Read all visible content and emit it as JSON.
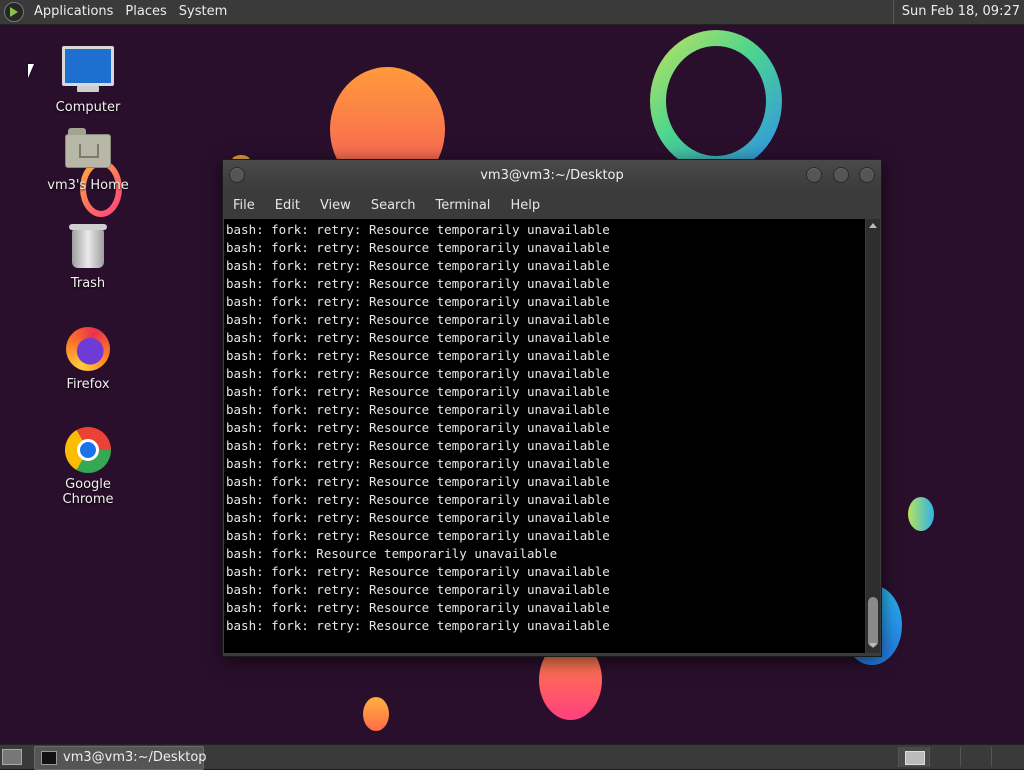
{
  "top_panel": {
    "menu": [
      "Applications",
      "Places",
      "System"
    ],
    "clock": "Sun Feb 18, 09:27"
  },
  "desktop": {
    "icons": [
      {
        "label": "Computer",
        "icon": "computer-icon"
      },
      {
        "label": "vm3's Home",
        "icon": "home-folder-icon"
      },
      {
        "label": "Trash",
        "icon": "trash-icon"
      },
      {
        "label": "Firefox",
        "icon": "firefox-icon"
      },
      {
        "label": "Google Chrome",
        "icon": "chrome-icon"
      }
    ]
  },
  "window": {
    "title": "vm3@vm3:~/Desktop",
    "menu": [
      "File",
      "Edit",
      "View",
      "Search",
      "Terminal",
      "Help"
    ],
    "terminal_lines": [
      "bash: fork: retry: Resource temporarily unavailable",
      "bash: fork: retry: Resource temporarily unavailable",
      "bash: fork: retry: Resource temporarily unavailable",
      "bash: fork: retry: Resource temporarily unavailable",
      "bash: fork: retry: Resource temporarily unavailable",
      "bash: fork: retry: Resource temporarily unavailable",
      "bash: fork: retry: Resource temporarily unavailable",
      "bash: fork: retry: Resource temporarily unavailable",
      "bash: fork: retry: Resource temporarily unavailable",
      "bash: fork: retry: Resource temporarily unavailable",
      "bash: fork: retry: Resource temporarily unavailable",
      "bash: fork: retry: Resource temporarily unavailable",
      "bash: fork: retry: Resource temporarily unavailable",
      "bash: fork: retry: Resource temporarily unavailable",
      "bash: fork: retry: Resource temporarily unavailable",
      "bash: fork: retry: Resource temporarily unavailable",
      "bash: fork: retry: Resource temporarily unavailable",
      "bash: fork: retry: Resource temporarily unavailable",
      "bash: fork: Resource temporarily unavailable",
      "bash: fork: retry: Resource temporarily unavailable",
      "bash: fork: retry: Resource temporarily unavailable",
      "bash: fork: retry: Resource temporarily unavailable",
      "bash: fork: retry: Resource temporarily unavailable"
    ]
  },
  "taskbar": {
    "task_label": "vm3@vm3:~/Desktop"
  }
}
